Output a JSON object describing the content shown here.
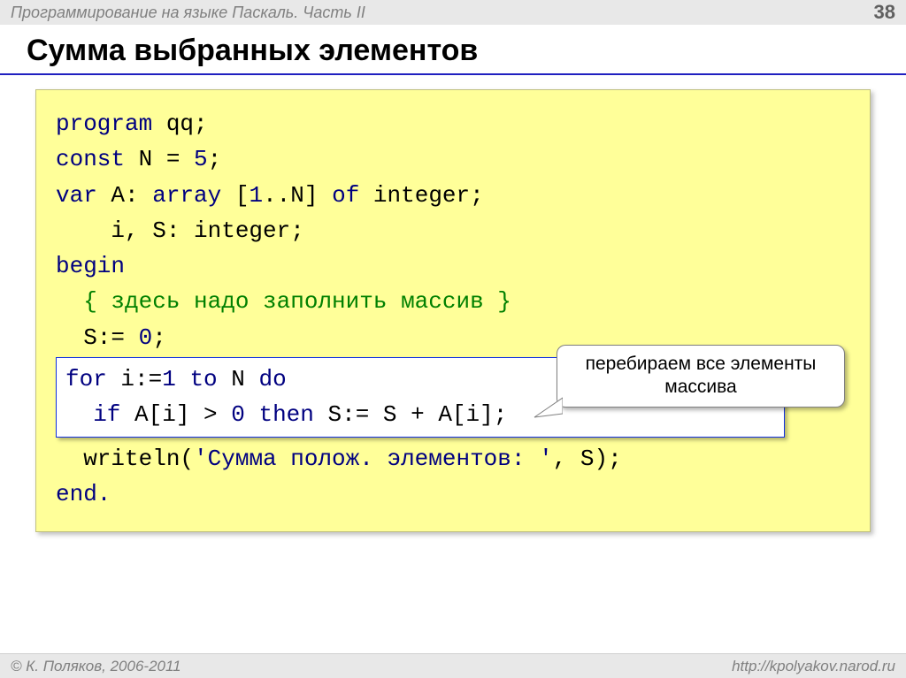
{
  "header": {
    "title": "Программирование на языке Паскаль. Часть II",
    "page": "38"
  },
  "title": "Сумма выбранных элементов",
  "code": {
    "l1a": "program",
    "l1b": " qq;",
    "l2a": "const",
    "l2b": " N = ",
    "l2c": "5",
    "l2d": ";",
    "l3a": "var",
    "l3b": " A: ",
    "l3c": "array",
    "l3d": " [",
    "l3e": "1",
    "l3f": "..N] ",
    "l3g": "of",
    "l3h": " integer;",
    "l4": "    i, S: integer;",
    "l5": "begin",
    "l6a": "  { здесь надо заполнить массив }",
    "l7a": "  S:= ",
    "l7b": "0",
    "l7c": ";",
    "l8a": "for",
    "l8b": " i:=",
    "l8c": "1",
    "l8d": " ",
    "l8e": "to",
    "l8f": " N ",
    "l8g": "do",
    "l9a": "  if",
    "l9b": " A[i] > ",
    "l9c": "0",
    "l9d": " ",
    "l9e": "then",
    "l9f": " S:= S + A[i];",
    "l10a": "  writeln(",
    "l10b": "'Сумма полож. элементов: '",
    "l10c": ", S);",
    "l11": "end."
  },
  "callout": "перебираем все элементы массива",
  "footer": {
    "left": "© К. Поляков, 2006-2011",
    "right": "http://kpolyakov.narod.ru"
  }
}
